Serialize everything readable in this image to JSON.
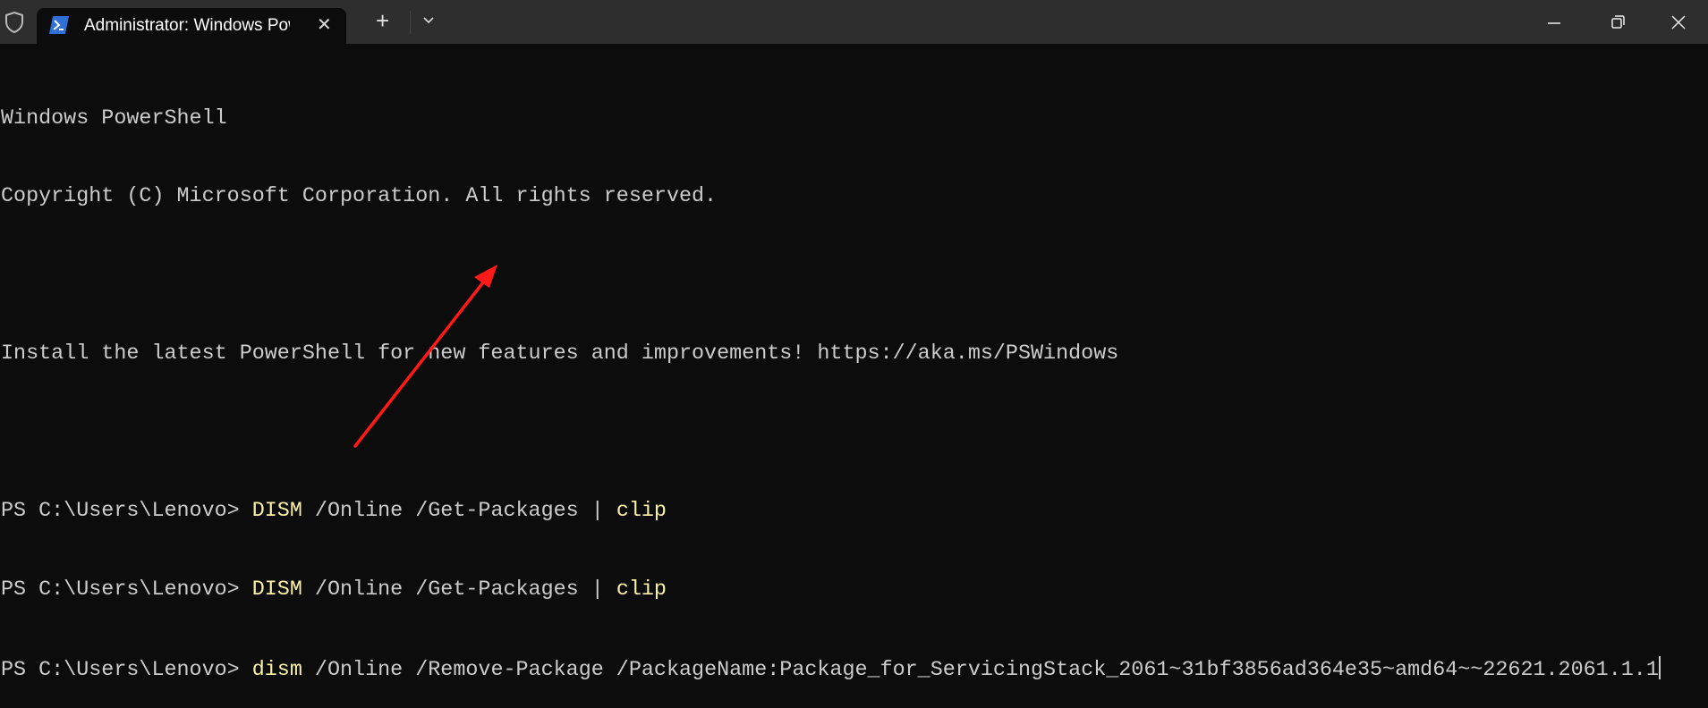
{
  "titlebar": {
    "tab_title": "Administrator: Windows PowerShell",
    "tab_icon": "powershell-icon",
    "close_tab": "✕",
    "new_tab": "+",
    "window_controls": [
      "minimize-icon",
      "restore-icon",
      "close-icon"
    ]
  },
  "terminal": {
    "header1": "Windows PowerShell",
    "header2": "Copyright (C) Microsoft Corporation. All rights reserved.",
    "install_msg": "Install the latest PowerShell for new features and improvements! https://aka.ms/PSWindows",
    "prompt": "PS C:\\Users\\Lenovo> ",
    "commands": [
      {
        "cmd": "DISM",
        "args": " /Online /Get-Packages | ",
        "pipe": "clip"
      },
      {
        "cmd": "DISM",
        "args": " /Online /Get-Packages | ",
        "pipe": "clip"
      },
      {
        "cmd": "dism",
        "args": " /Online /Remove-Package /PackageName:Package_for_ServicingStack_2061~31bf3856ad364e35~amd64~~22621.2061.1.1",
        "pipe": ""
      }
    ]
  },
  "colors": {
    "background": "#0c0c0c",
    "titlebar": "#2e2e2e",
    "command": "#f9f1a5",
    "text": "#cccccc",
    "annotation_arrow": "#ff0000"
  }
}
